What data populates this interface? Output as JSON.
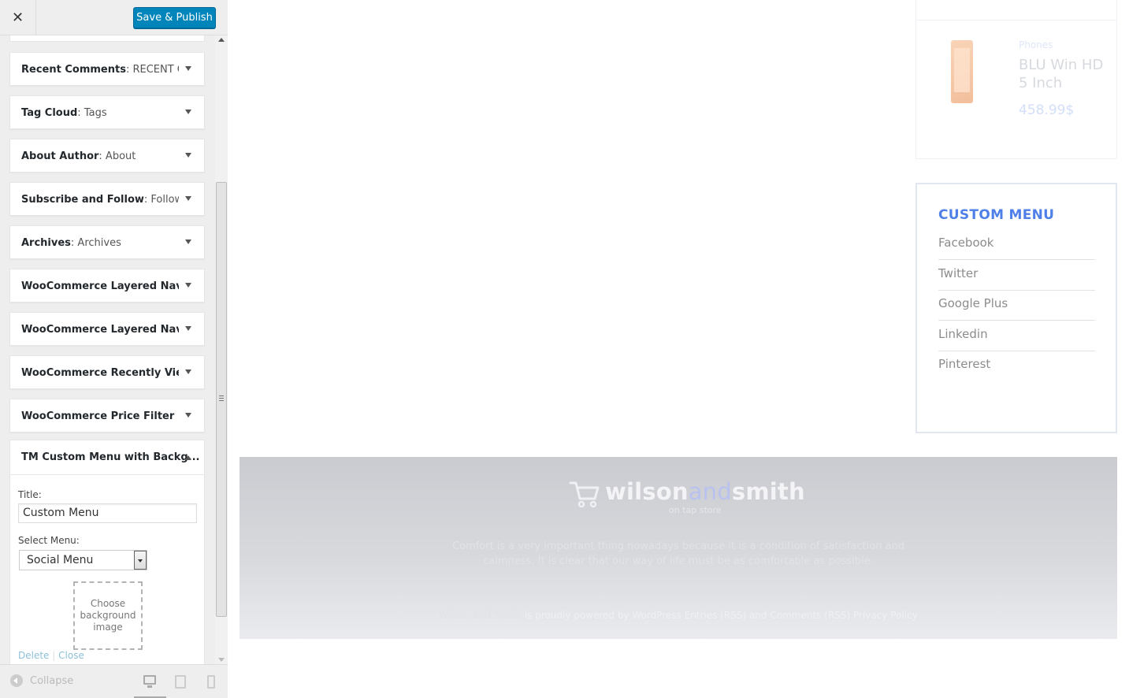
{
  "topbar": {
    "close_glyph": "✕",
    "publish_label": "Save & Publish"
  },
  "widgets": [
    {
      "name": "Recent Comments",
      "sub": ": RECENT C..."
    },
    {
      "name": "Tag Cloud",
      "sub": ": Tags"
    },
    {
      "name": "About Author",
      "sub": ": About"
    },
    {
      "name": "Subscribe and Follow",
      "sub": ": Follow..."
    },
    {
      "name": "Archives",
      "sub": ": Archives"
    },
    {
      "name": "WooCommerce Layered Nav: ...",
      "sub": ""
    },
    {
      "name": "WooCommerce Layered Nav ...",
      "sub": ""
    },
    {
      "name": "WooCommerce Recently View...",
      "sub": ""
    },
    {
      "name": "WooCommerce Price Filter",
      "sub": ""
    }
  ],
  "expanded_widget": {
    "name": "TM Custom Menu with Backg...",
    "title_label": "Title:",
    "title_value": "Custom Menu",
    "select_label": "Select Menu:",
    "select_value": "Social Menu",
    "bg_button": "Choose background image",
    "delete_link": "Delete",
    "separator": "|",
    "close_link": "Close"
  },
  "footer": {
    "collapse_label": "Collapse"
  },
  "preview": {
    "product": {
      "category": "Phones",
      "name": "BLU Win HD 5 Inch",
      "price": "458.99$"
    },
    "custom_menu": {
      "title": "CUSTOM MENU",
      "items": [
        "Facebook",
        "Twitter",
        "Google Plus",
        "Linkedin",
        "Pinterest"
      ]
    },
    "site_footer": {
      "brand_left": "wilson",
      "brand_mid": "and",
      "brand_right": "smith",
      "tagline": "on tap store",
      "blurb": "Comfort is a very important thing nowadays because it is a condition of satisfaction and calmness. It is clear that our way of life must be as comfortable as possible.",
      "credit_owner": "Wilson and Smith",
      "credit_rest": " is proudly powered by WordPress Entries (RSS) and Comments (RSS) Privacy Policy"
    }
  },
  "colors": {
    "publish": "#0085ba",
    "menu_title": "#4f7fe9",
    "link": "#0073aa"
  }
}
